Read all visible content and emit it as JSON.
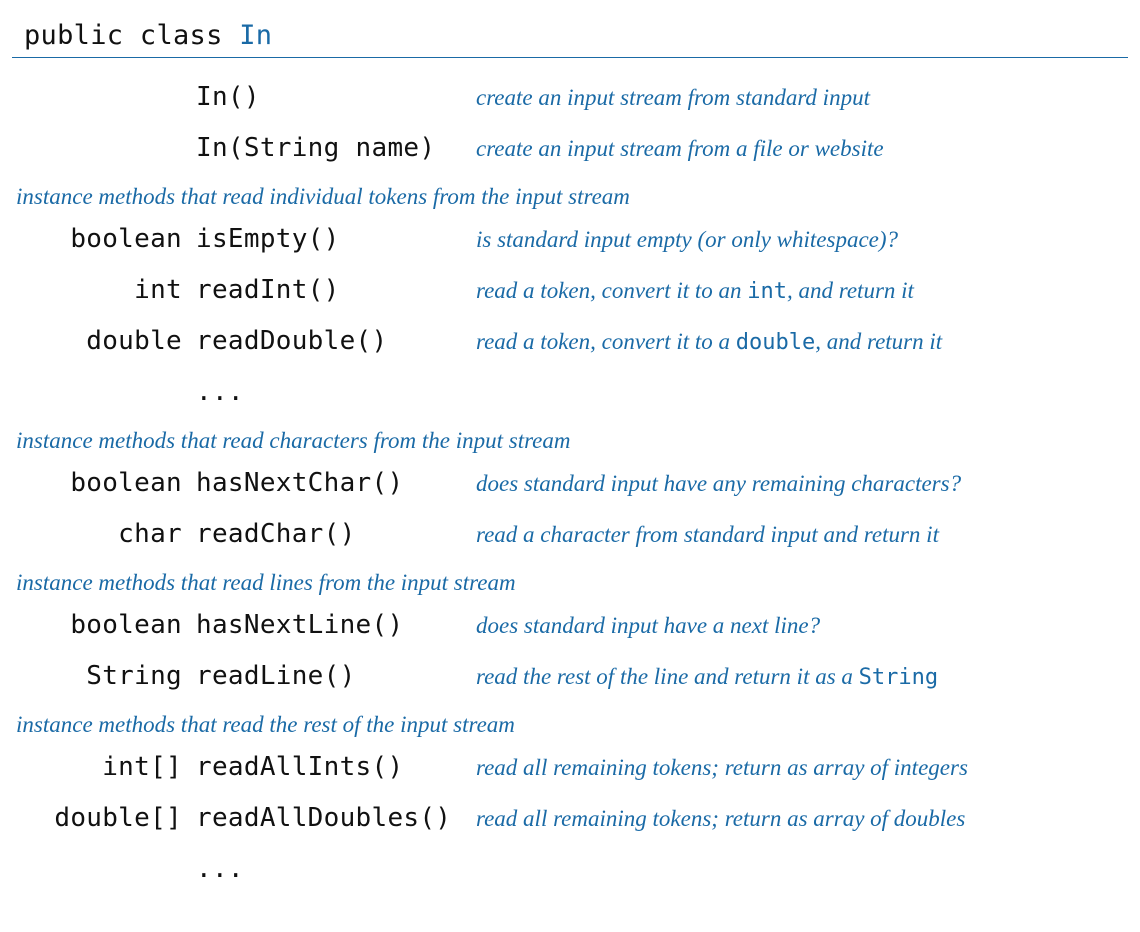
{
  "header": {
    "prefix": "public class ",
    "className": "In"
  },
  "constructors": [
    {
      "ret": "",
      "sig": "In()",
      "desc_parts": [
        {
          "t": "create an input stream from standard input"
        }
      ]
    },
    {
      "ret": "",
      "sig": "In(String name)",
      "desc_parts": [
        {
          "t": "create an input stream from a file or website"
        }
      ]
    }
  ],
  "sections": [
    {
      "title": "instance methods that read individual tokens from the input stream",
      "rows": [
        {
          "ret": "boolean",
          "sig": "isEmpty()",
          "desc_parts": [
            {
              "t": "is standard input empty (or only whitespace)?"
            }
          ]
        },
        {
          "ret": "int",
          "sig": "readInt()",
          "desc_parts": [
            {
              "t": "read a token, convert it to an "
            },
            {
              "c": "int"
            },
            {
              "t": ", and return it"
            }
          ]
        },
        {
          "ret": "double",
          "sig": "readDouble()",
          "desc_parts": [
            {
              "t": "read a token, convert it to a "
            },
            {
              "c": "double"
            },
            {
              "t": ", and return it"
            }
          ]
        },
        {
          "ret": "",
          "sig": "...",
          "desc_parts": []
        }
      ]
    },
    {
      "title": "instance methods that read characters from the input stream",
      "rows": [
        {
          "ret": "boolean",
          "sig": "hasNextChar()",
          "desc_parts": [
            {
              "t": "does standard input have any remaining characters?"
            }
          ]
        },
        {
          "ret": "char",
          "sig": "readChar()",
          "desc_parts": [
            {
              "t": "read a character from standard input and return it"
            }
          ]
        }
      ]
    },
    {
      "title": "instance methods that read lines from the input stream",
      "rows": [
        {
          "ret": "boolean",
          "sig": "hasNextLine()",
          "desc_parts": [
            {
              "t": "does standard input have a next line?"
            }
          ]
        },
        {
          "ret": "String",
          "sig": "readLine()",
          "desc_parts": [
            {
              "t": "read the rest of the line and return it as a "
            },
            {
              "c": "String"
            }
          ]
        }
      ]
    },
    {
      "title": "instance methods that read the rest of  the input stream",
      "rows": [
        {
          "ret": "int[]",
          "sig": "readAllInts()",
          "desc_parts": [
            {
              "t": "read all remaining tokens; return as array of integers"
            }
          ]
        },
        {
          "ret": "double[]",
          "sig": "readAllDoubles()",
          "desc_parts": [
            {
              "t": "read all remaining tokens; return as array of doubles"
            }
          ]
        },
        {
          "ret": "",
          "sig": "...",
          "desc_parts": []
        }
      ]
    }
  ]
}
